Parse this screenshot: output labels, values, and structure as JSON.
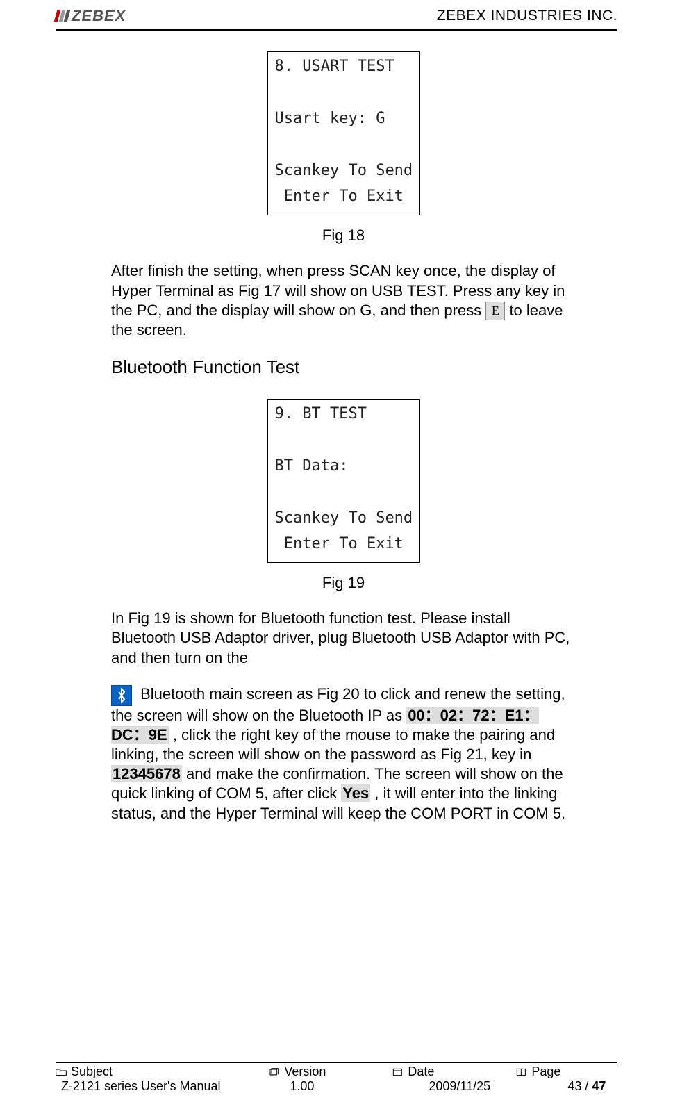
{
  "header": {
    "logo_text": "ZEBEX",
    "company": "ZEBEX INDUSTRIES INC."
  },
  "fig18": {
    "lcd_text": "8. USART TEST\n\nUsart key: G\n\nScankey To Send\n Enter To Exit",
    "caption": "Fig 18"
  },
  "para1": {
    "pre": "After finish the setting, when press SCAN key once, the display of Hyper Terminal as Fig 17 will show on USB TEST. Press any key in the PC, and the display will show on G, and then press ",
    "key": "E",
    "post": " to leave the screen."
  },
  "heading_bt": "Bluetooth Function Test",
  "fig19": {
    "lcd_text": "9. BT TEST\n\nBT Data:\n\nScankey To Send\n Enter To Exit",
    "caption": "Fig 19"
  },
  "para2": {
    "p1": "In Fig 19 is shown for Bluetooth function test. Please install Bluetooth USB Adaptor driver, plug Bluetooth USB Adaptor with PC, and then turn on the",
    "p2a": "Bluetooth main screen as Fig 20 to click and renew the setting, the screen will show on the Bluetooth IP as ",
    "ip": "00：02：72：E1：DC：9E",
    "p2b": ", click the right key of the mouse to make the pairing and linking, the screen will show on the password as Fig 21, key in ",
    "pwd": "12345678",
    "p2c": " and make the confirmation. The screen will show on the quick linking of COM 5, after click ",
    "yes": "Yes",
    "p2d": ", it will enter into the linking status, and the Hyper Terminal will keep the COM PORT in COM 5."
  },
  "footer": {
    "labels": {
      "subject": "Subject",
      "version": "Version",
      "date": "Date",
      "page": "Page"
    },
    "values": {
      "subject": "Z-2121 series User's Manual",
      "version": "1.00",
      "date": "2009/11/25",
      "page_current": "43",
      "page_sep": " / ",
      "page_total": "47"
    }
  }
}
